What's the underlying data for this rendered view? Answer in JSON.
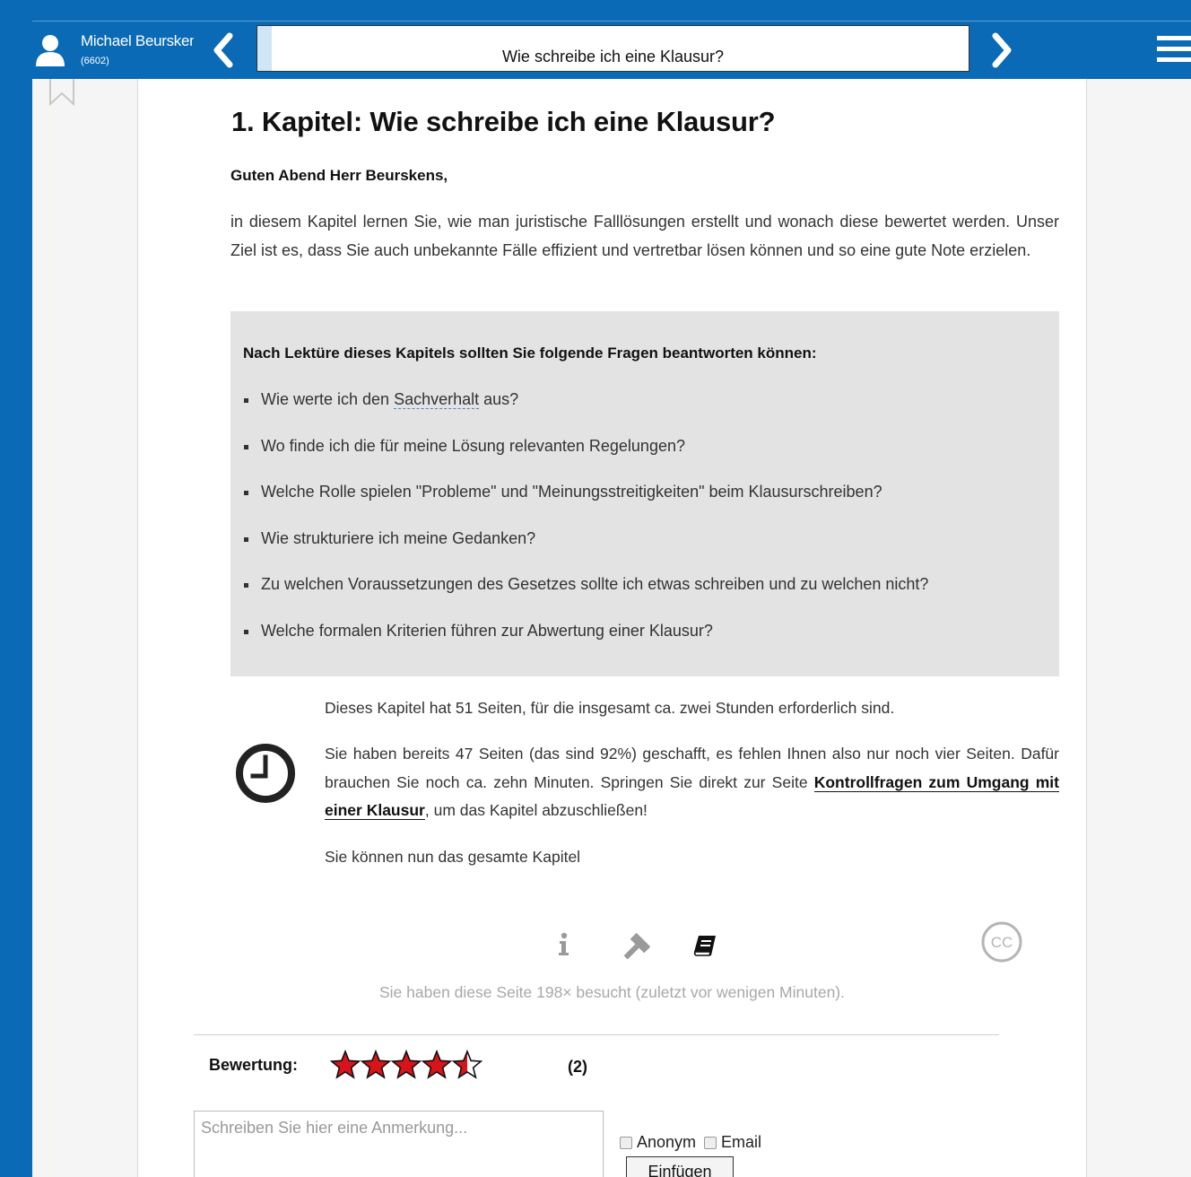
{
  "header": {
    "user_name": "Michael Beurskens",
    "user_id": "(6602)",
    "chapter_title": "Wie schreibe ich eine Klausur?"
  },
  "main": {
    "heading": "1. Kapitel: Wie schreibe ich eine Klausur?",
    "greeting": "Guten Abend Herr Beurskens,",
    "intro": "in diesem Kapitel lernen Sie, wie man juristische Falllösungen erstellt und wonach diese bewertet werden. Unser Ziel ist es, dass Sie auch unbekannte Fälle effizient und vertretbar lösen können und so eine gute Note erzielen.",
    "questions_heading": "Nach Lektüre dieses Kapitels sollten Sie folgende Fragen beantworten können:",
    "questions": [
      {
        "before": "Wie werte ich den ",
        "term": "Sachverhalt",
        "after": " aus?"
      },
      {
        "before": "Wo finde ich die für meine Lösung relevanten Regelungen?",
        "term": "",
        "after": ""
      },
      {
        "before": "Welche Rolle spielen \"Probleme\" und \"Meinungsstreitigkeiten\" beim Klausurschreiben?",
        "term": "",
        "after": ""
      },
      {
        "before": "Wie strukturiere ich meine Gedanken?",
        "term": "",
        "after": ""
      },
      {
        "before": "Zu welchen Voraussetzungen des Gesetzes sollte ich etwas schreiben und zu welchen nicht?",
        "term": "",
        "after": ""
      },
      {
        "before": "Welche formalen Kriterien führen zur Abwertung einer Klausur?",
        "term": "",
        "after": ""
      }
    ],
    "progress_info_1": "Dieses Kapitel hat 51 Seiten, für die insgesamt ca. zwei Stunden erforderlich sind.",
    "progress_info_2_before": "Sie haben bereits 47 Seiten (das sind 92%) geschafft, es fehlen Ihnen also nur noch vier Seiten. Dafür brauchen Sie noch ca. zehn Minuten. Springen Sie direkt zur Seite ",
    "progress_info_2_link": "Kontrollfragen zum Umgang mit einer Klausur",
    "progress_info_2_after": ", um das Kapitel abzuschließen!",
    "progress_info_3": "Sie können nun das gesamte Kapitel",
    "visited": "Sie haben diese Seite 198× besucht (zuletzt vor wenigen Minuten)."
  },
  "rating": {
    "label": "Bewertung:",
    "value": 4.5,
    "max": 5,
    "count": "(2)"
  },
  "comment": {
    "placeholder": "Schreiben Sie hier eine Anmerkung...",
    "anonymous_label": "Anonym",
    "email_label": "Email",
    "submit_label": "Einfügen"
  },
  "colors": {
    "brand": "#0a6ab5",
    "star": "#d9131a",
    "question_box": "#e3e3e3"
  },
  "icons": [
    "user-icon",
    "chevron-left-icon",
    "chevron-right-icon",
    "menu-icon",
    "bookmark-icon",
    "clock-icon",
    "info-icon",
    "hammer-icon",
    "book-icon",
    "cc-icon",
    "star-icon"
  ]
}
